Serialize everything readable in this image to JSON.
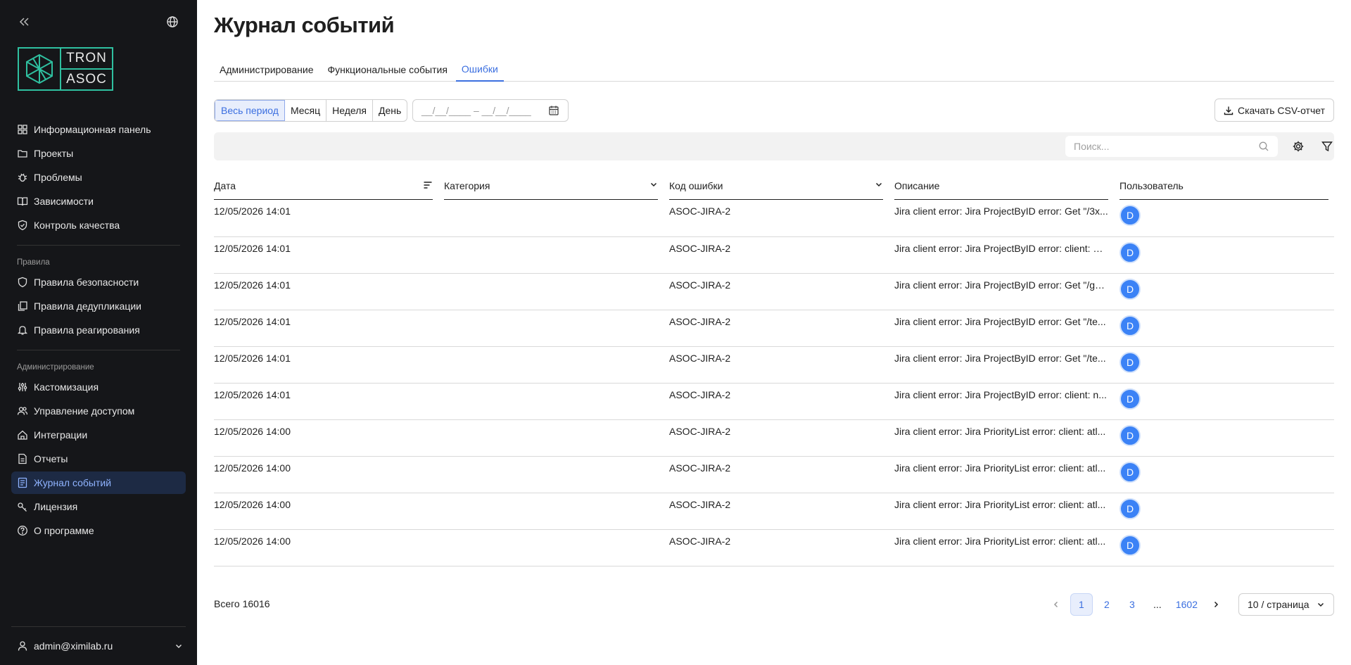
{
  "sidebar": {
    "logo": {
      "line1": "TRON",
      "line2": "ASOC"
    },
    "main_items": [
      {
        "label": "Информационная панель",
        "icon": "dashboard-icon"
      },
      {
        "label": "Проекты",
        "icon": "folder-icon"
      },
      {
        "label": "Проблемы",
        "icon": "bug-icon"
      },
      {
        "label": "Зависимости",
        "icon": "book-icon"
      },
      {
        "label": "Контроль качества",
        "icon": "shield-check-icon"
      }
    ],
    "rules_section": "Правила",
    "rules_items": [
      {
        "label": "Правила безопасности",
        "icon": "shield-icon"
      },
      {
        "label": "Правила дедупликации",
        "icon": "copy-icon"
      },
      {
        "label": "Правила реагирования",
        "icon": "bell-icon"
      }
    ],
    "admin_section": "Администрирование",
    "admin_items": [
      {
        "label": "Кастомизация",
        "icon": "sliders-icon"
      },
      {
        "label": "Управление доступом",
        "icon": "users-icon"
      },
      {
        "label": "Интеграции",
        "icon": "integration-icon"
      },
      {
        "label": "Отчеты",
        "icon": "report-icon"
      },
      {
        "label": "Журнал событий",
        "icon": "log-icon",
        "active": true
      },
      {
        "label": "Лицензия",
        "icon": "key-icon"
      },
      {
        "label": "О программе",
        "icon": "help-icon"
      }
    ],
    "user": "admin@ximilab.ru"
  },
  "page": {
    "title": "Журнал событий"
  },
  "tabs": [
    {
      "label": "Администрирование"
    },
    {
      "label": "Функциональные события"
    },
    {
      "label": "Ошибки",
      "active": true
    }
  ],
  "period": [
    "Весь период",
    "Месяц",
    "Неделя",
    "День"
  ],
  "date_range": {
    "placeholder": "__/__/____ – __/__/____"
  },
  "csv_button": "Скачать CSV-отчет",
  "search": {
    "placeholder": "Поиск..."
  },
  "columns": [
    "Дата",
    "Категория",
    "Код ошибки",
    "Описание",
    "Пользователь"
  ],
  "rows": [
    {
      "date": "12/05/2026 14:01",
      "category": "",
      "code": "ASOC-JIRA-2",
      "description": "Jira client error: Jira ProjectByID error: Get \"/3x...",
      "user": "D"
    },
    {
      "date": "12/05/2026 14:01",
      "category": "",
      "code": "ASOC-JIRA-2",
      "description": "Jira client error: Jira ProjectByID error: client: at...",
      "user": "D"
    },
    {
      "date": "12/05/2026 14:01",
      "category": "",
      "code": "ASOC-JIRA-2",
      "description": "Jira client error: Jira ProjectByID error: Get \"/go...",
      "user": "D"
    },
    {
      "date": "12/05/2026 14:01",
      "category": "",
      "code": "ASOC-JIRA-2",
      "description": "Jira client error: Jira ProjectByID error: Get \"/te...",
      "user": "D"
    },
    {
      "date": "12/05/2026 14:01",
      "category": "",
      "code": "ASOC-JIRA-2",
      "description": "Jira client error: Jira ProjectByID error: Get \"/te...",
      "user": "D"
    },
    {
      "date": "12/05/2026 14:01",
      "category": "",
      "code": "ASOC-JIRA-2",
      "description": "Jira client error: Jira ProjectByID error: client: n...",
      "user": "D"
    },
    {
      "date": "12/05/2026 14:00",
      "category": "",
      "code": "ASOC-JIRA-2",
      "description": "Jira client error: Jira PriorityList error: client: atl...",
      "user": "D"
    },
    {
      "date": "12/05/2026 14:00",
      "category": "",
      "code": "ASOC-JIRA-2",
      "description": "Jira client error: Jira PriorityList error: client: atl...",
      "user": "D"
    },
    {
      "date": "12/05/2026 14:00",
      "category": "",
      "code": "ASOC-JIRA-2",
      "description": "Jira client error: Jira PriorityList error: client: atl...",
      "user": "D"
    },
    {
      "date": "12/05/2026 14:00",
      "category": "",
      "code": "ASOC-JIRA-2",
      "description": "Jira client error: Jira PriorityList error: client: atl...",
      "user": "D"
    }
  ],
  "footer": {
    "total": "Всего 16016",
    "pages": [
      "1",
      "2",
      "3",
      "...",
      "1602"
    ],
    "current_page": "1",
    "page_size": "10 / страница"
  },
  "colors": {
    "sidebar_bg": "#151619",
    "accent": "#3b6fe0",
    "logo": "#2fc0a0",
    "avatar": "#3b82f6"
  }
}
